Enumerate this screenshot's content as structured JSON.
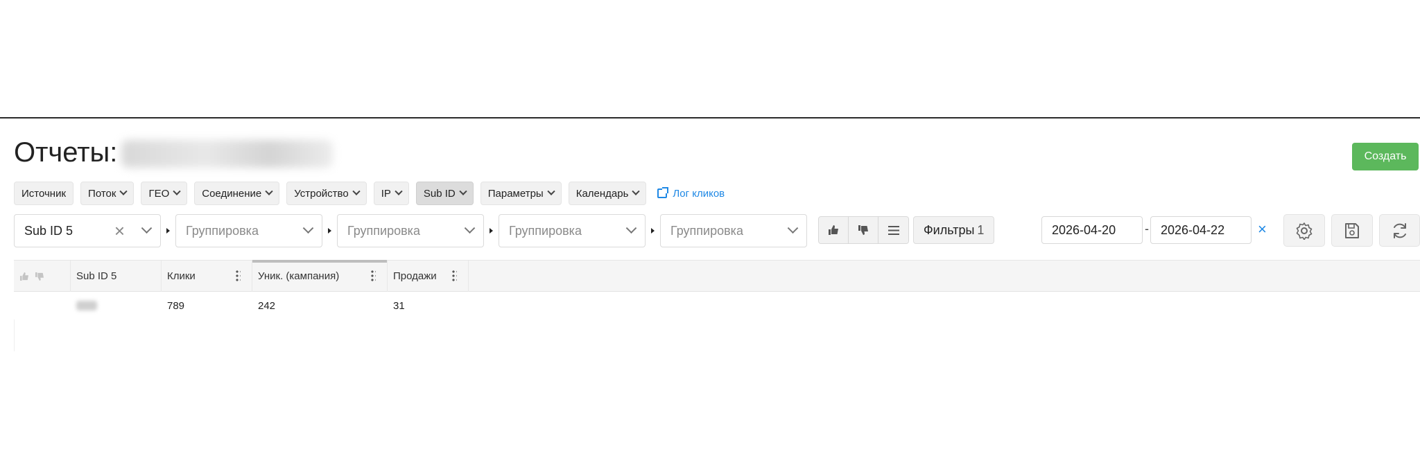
{
  "header": {
    "title": "Отчеты:",
    "create_label": "Создать"
  },
  "report_tabs": [
    {
      "label": "Источник",
      "has_dropdown": false,
      "active": false
    },
    {
      "label": "Поток",
      "has_dropdown": true,
      "active": false
    },
    {
      "label": "ГЕО",
      "has_dropdown": true,
      "active": false
    },
    {
      "label": "Соединение",
      "has_dropdown": true,
      "active": false
    },
    {
      "label": "Устройство",
      "has_dropdown": true,
      "active": false
    },
    {
      "label": "IP",
      "has_dropdown": true,
      "active": false
    },
    {
      "label": "Sub ID",
      "has_dropdown": true,
      "active": true
    },
    {
      "label": "Параметры",
      "has_dropdown": true,
      "active": false
    },
    {
      "label": "Календарь",
      "has_dropdown": true,
      "active": false
    }
  ],
  "log_link": {
    "label": "Лог кликов",
    "icon": "external-link-icon"
  },
  "grouping": {
    "selected": "Sub ID 5",
    "placeholders": [
      "Группировка",
      "Группировка",
      "Группировка",
      "Группировка"
    ]
  },
  "vote_buttons": [
    {
      "icon": "thumbs-up-icon"
    },
    {
      "icon": "thumbs-down-icon"
    },
    {
      "icon": "list-icon"
    }
  ],
  "filters": {
    "label": "Фильтры",
    "count": "1"
  },
  "dates": {
    "from": "2026-04-20",
    "separator": "-",
    "to": "2026-04-22",
    "clear": "×"
  },
  "actions": [
    {
      "icon": "gear-icon"
    },
    {
      "icon": "save-icon"
    },
    {
      "icon": "refresh-icon"
    }
  ],
  "table": {
    "columns": [
      "Sub ID 5",
      "Клики",
      "Уник. (кампания)",
      "Продажи"
    ],
    "rows": [
      {
        "sub_id": "",
        "clicks": "789",
        "unique": "242",
        "sales": "31"
      }
    ]
  },
  "colors": {
    "accent_green": "#5cb85c",
    "link_blue": "#1e88e5"
  }
}
